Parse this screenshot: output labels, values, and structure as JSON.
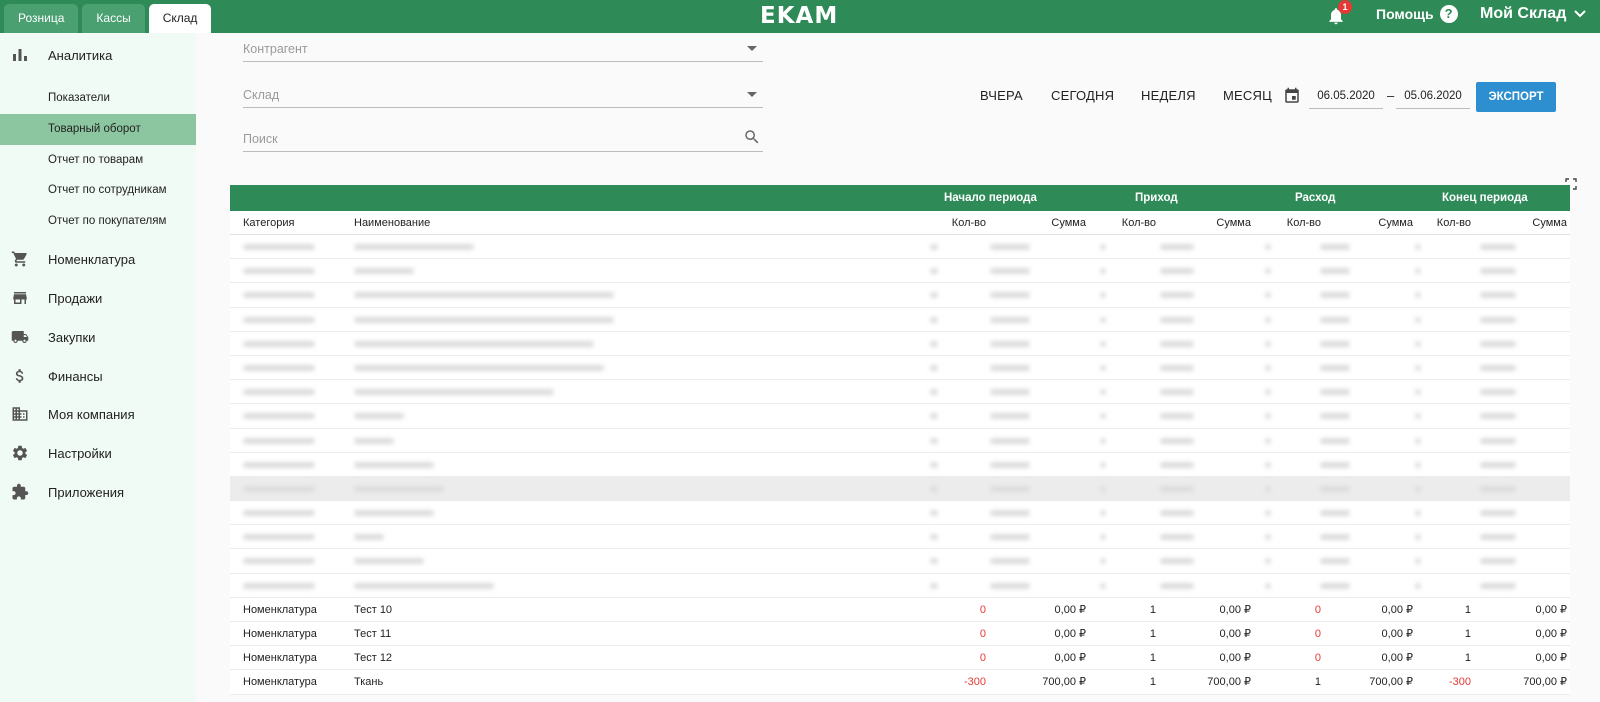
{
  "topbar": {
    "tabs": [
      {
        "label": "Розница",
        "active": false
      },
      {
        "label": "Кассы",
        "active": false
      },
      {
        "label": "Склад",
        "active": true
      }
    ],
    "logo": "EKAM",
    "notifications": "1",
    "help": "Помощь",
    "help_icon": "?",
    "account": "Мой Склад"
  },
  "sidebar": {
    "analytics": "Аналитика",
    "sub": [
      "Показатели",
      "Товарный оборот",
      "Отчет по товарам",
      "Отчет по сотрудникам",
      "Отчет по покупателям"
    ],
    "items": [
      "Номенклатура",
      "Продажи",
      "Закупки",
      "Финансы",
      "Моя компания",
      "Настройки",
      "Приложения"
    ]
  },
  "filters": {
    "counterparty": "Контрагент",
    "warehouse": "Склад",
    "search": "Поиск"
  },
  "period": {
    "yesterday": "ВЧЕРА",
    "today": "СЕГОДНЯ",
    "week": "НЕДЕЛЯ",
    "month": "МЕСЯЦ",
    "date_from": "06.05.2020",
    "date_to": "05.06.2020",
    "dash": "–",
    "export": "ЭКСПОРТ"
  },
  "table": {
    "groups": [
      "Начало периода",
      "Приход",
      "Расход",
      "Конец периода"
    ],
    "columns": {
      "category": "Категория",
      "name": "Наименование",
      "qty": "Кол-во",
      "sum": "Сумма"
    },
    "rows": [
      {
        "cat": "Номенклатура",
        "name": "Тест 10",
        "v": [
          "0",
          "0,00 ₽",
          "1",
          "0,00 ₽",
          "0",
          "0,00 ₽",
          "1",
          "0,00 ₽"
        ]
      },
      {
        "cat": "Номенклатура",
        "name": "Тест 11",
        "v": [
          "0",
          "0,00 ₽",
          "1",
          "0,00 ₽",
          "0",
          "0,00 ₽",
          "1",
          "0,00 ₽"
        ]
      },
      {
        "cat": "Номенклатура",
        "name": "Тест 12",
        "v": [
          "0",
          "0,00 ₽",
          "1",
          "0,00 ₽",
          "0",
          "0,00 ₽",
          "1",
          "0,00 ₽"
        ]
      },
      {
        "cat": "Номенклатура",
        "name": "Ткань",
        "v": [
          "-300",
          "700,00 ₽",
          "1",
          "700,00 ₽",
          "1",
          "700,00 ₽",
          "-300",
          "700,00 ₽"
        ]
      }
    ]
  }
}
